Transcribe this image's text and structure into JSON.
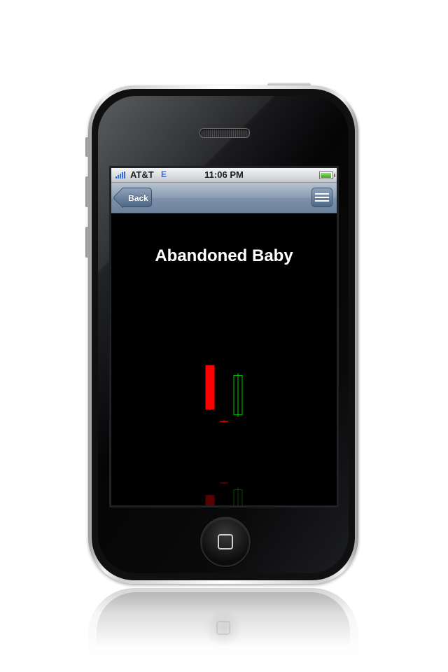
{
  "status_bar": {
    "carrier": "AT&T",
    "network": "E",
    "time": "11:06 PM"
  },
  "nav_bar": {
    "back_label": "Back",
    "menu_icon": "list-icon"
  },
  "content": {
    "title": "Abandoned Baby"
  },
  "chart_data": {
    "type": "candlestick",
    "title": "",
    "candles": [
      {
        "direction": "bearish",
        "color": "#ff0000",
        "open": 100,
        "close": 22,
        "high": 100,
        "low": 20,
        "filled": true
      },
      {
        "direction": "doji",
        "color": "#ff0000",
        "open": 0,
        "close": 0,
        "high": 2,
        "low": -2,
        "filled": false
      },
      {
        "direction": "bullish",
        "color": "#00cc00",
        "open": 12,
        "close": 82,
        "high": 86,
        "low": 8,
        "filled": false
      }
    ]
  },
  "colors": {
    "screen_background": "#000000",
    "title_text": "#ffffff",
    "nav_bar": "#6d829c"
  }
}
